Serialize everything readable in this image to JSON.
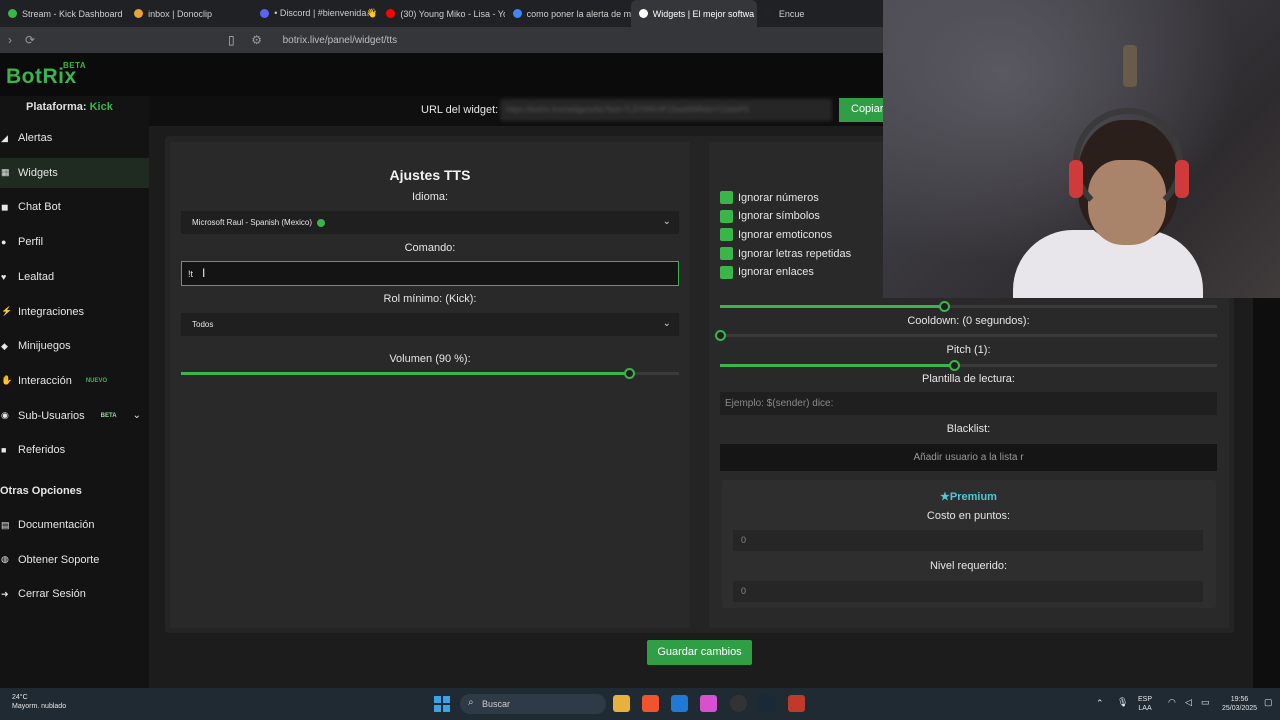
{
  "browser": {
    "tabs": [
      {
        "label": "Stream - Kick Dashboard",
        "color": "#3ab54a",
        "active": false
      },
      {
        "label": "inbox | Donoclip",
        "color": "#e8a33a",
        "active": false
      },
      {
        "label": "• Discord | #bienvenida👋 | SK",
        "color": "#5865f2",
        "active": false
      },
      {
        "label": "(30) Young Miko - Lisa - YouTu",
        "color": "#ff0000",
        "active": false
      },
      {
        "label": "como poner la alerta de mi fo",
        "color": "#4285f4",
        "active": false
      },
      {
        "label": "Widgets | El mejor softwa",
        "color": "#ffffff",
        "active": true
      },
      {
        "label": "Encue",
        "color": "#222222",
        "active": false
      }
    ],
    "url": "botrix.live/panel/widget/tts"
  },
  "app": {
    "logo": "BotRix",
    "logo_badge": "BETA",
    "accent": "#3ab54a"
  },
  "sidebar": {
    "platform_label": "Plataforma:",
    "platform_value": "Kick",
    "items": [
      {
        "label": "Alertas",
        "icon": "bell-icon"
      },
      {
        "label": "Widgets",
        "icon": "widget-icon"
      },
      {
        "label": "Chat Bot",
        "icon": "chat-icon"
      },
      {
        "label": "Perfil",
        "icon": "user-icon"
      },
      {
        "label": "Lealtad",
        "icon": "heart-icon"
      },
      {
        "label": "Integraciones",
        "icon": "plug-icon"
      },
      {
        "label": "Minijuegos",
        "icon": "gamepad-icon"
      },
      {
        "label": "Interacción",
        "icon": "hand-icon",
        "badge": "NUEVO"
      },
      {
        "label": "Sub-Usuarios",
        "icon": "users-icon",
        "badge": "BETA"
      },
      {
        "label": "Referidos",
        "icon": "gift-icon"
      }
    ],
    "other_heading": "Otras Opciones",
    "other_items": [
      {
        "label": "Documentación",
        "icon": "book-icon"
      },
      {
        "label": "Obtener Soporte",
        "icon": "support-icon"
      },
      {
        "label": "Cerrar Sesión",
        "icon": "logout-icon"
      }
    ]
  },
  "widget_url": {
    "label": "URL del widget:",
    "value": "https://botrix.live/widgets/tts?bid=7LSYWKHPZ6aaWMNdnYGbdxPK",
    "copy_label": "Copiar"
  },
  "tts": {
    "title": "Ajustes TTS",
    "language_label": "Idioma:",
    "language_value": "Microsoft Raul - Spanish (Mexico)",
    "command_label": "Comando:",
    "command_value": "!t",
    "role_label": "Rol mínimo: (Kick):",
    "role_value": "Todos",
    "volume_label": "Volumen (90 %):",
    "volume_fraction": 0.9
  },
  "right": {
    "checks": [
      "Ignorar números",
      "Ignorar símbolos",
      "Ignorar emoticonos",
      "Ignorar letras repetidas",
      "Ignorar enlaces"
    ],
    "speed_fraction": 0.45,
    "cooldown_label": "Cooldown: (0 segundos):",
    "cooldown_fraction": 0,
    "pitch_label": "Pitch (1):",
    "pitch_fraction": 0.47,
    "template_label": "Plantilla de lectura:",
    "template_placeholder": "Ejemplo: $(sender) dice:",
    "blacklist_label": "Blacklist:",
    "blacklist_placeholder": "Añadir usuario a la lista r",
    "premium_label": "Premium",
    "cost_label": "Costo en puntos:",
    "cost_value": "0",
    "level_label": "Nivel requerido:",
    "level_value": "0"
  },
  "save_label": "Guardar cambios",
  "taskbar": {
    "weather_temp": "24°C",
    "weather_desc": "Mayorm. nublado",
    "search_placeholder": "Buscar",
    "lang": "ESP",
    "region": "LAA",
    "time": "19:56",
    "date": "25/03/2025"
  }
}
